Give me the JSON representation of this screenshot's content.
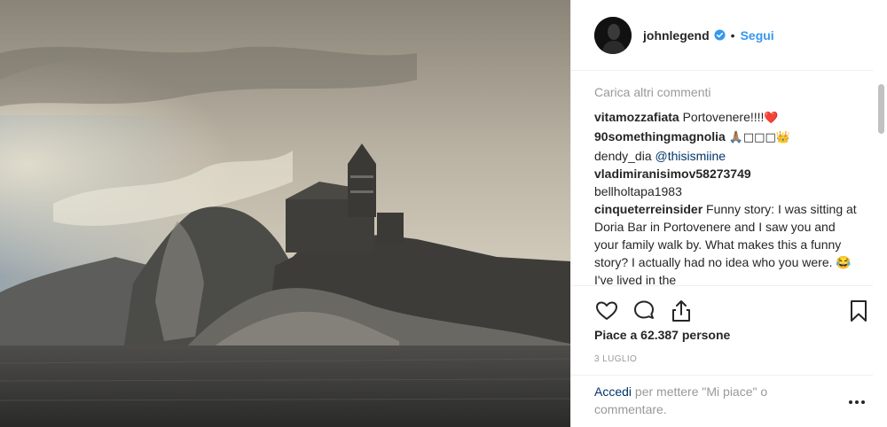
{
  "post": {
    "username": "johnlegend",
    "dot": "•",
    "follow_label": "Segui",
    "load_more_label": "Carica altri commenti",
    "comments": [
      {
        "user": "vitamozzafiata",
        "text": "Portovenere!!!!",
        "emoji": "❤️"
      },
      {
        "user": "90somethingmagnolia",
        "text": "",
        "emoji": "🙏🏽□□□👑"
      },
      {
        "user": "dendy_dia",
        "mention": "@thisismiine"
      },
      {
        "user": "vladimiranisimov58273749",
        "text": ""
      },
      {
        "user": "",
        "text": "bellholtapa1983"
      },
      {
        "user": "cinqueterreinsider",
        "text": "Funny story: I was sitting at Doria Bar in Portovenere and I saw you and your family walk by. What makes this a funny story? I actually had no idea who you were. 😂 I've lived in the"
      }
    ],
    "likes_text": "Piace a 62.387 persone",
    "date": "3 LUGLIO",
    "login_link": "Accedi",
    "login_rest": "per mettere \"Mi piace\" o commentare.",
    "more_label": "•••"
  },
  "icons": {
    "like": "heart-icon",
    "comment": "comment-icon",
    "share": "share-icon",
    "save": "bookmark-icon",
    "verified": "verified-badge-icon"
  },
  "colors": {
    "link": "#3897f0",
    "mention": "#003569",
    "muted": "#999999",
    "verified": "#3897f0"
  }
}
